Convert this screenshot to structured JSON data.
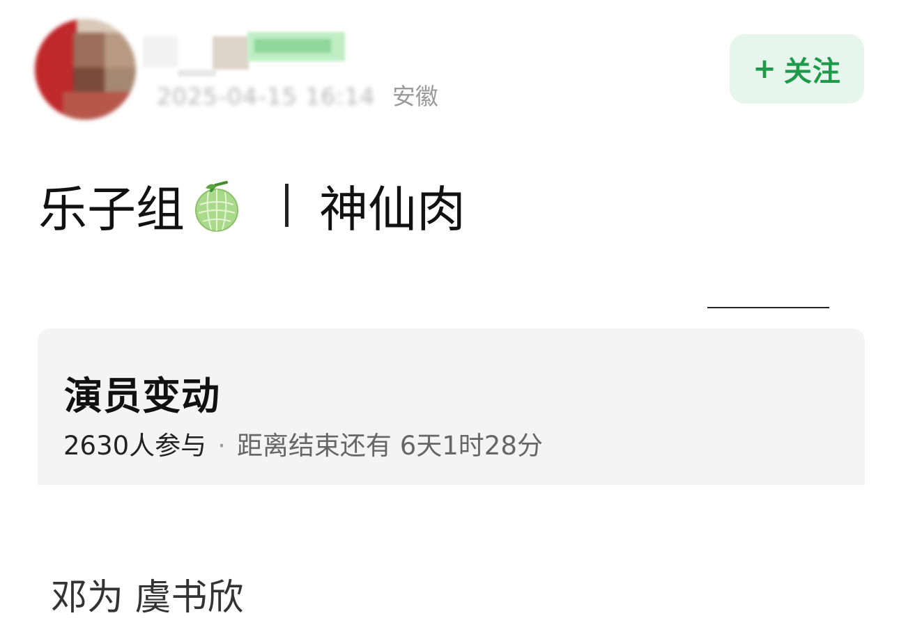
{
  "header": {
    "timestamp": "2025-04-15 16:14",
    "region": "安徽",
    "follow_label": "关注",
    "follow_icon": "plus-icon"
  },
  "post": {
    "title_left": "乐子组",
    "title_icon": "melon-emoji",
    "title_right": "神仙肉"
  },
  "poll": {
    "title": "演员变动",
    "participants": "2630人参与",
    "separator": "·",
    "remaining": "距离结束还有 6天1时28分"
  },
  "option": {
    "text": "邓为 虞书欣"
  },
  "colors": {
    "accent_green": "#1f9a4c",
    "follow_bg": "#e7f6ec",
    "card_bg": "#f4f4f4"
  }
}
